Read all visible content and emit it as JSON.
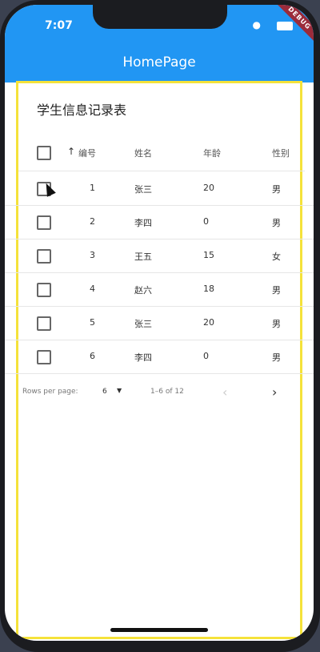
{
  "status_bar": {
    "time": "7:07",
    "debug": "DEBUG"
  },
  "app_bar": {
    "title": "HomePage"
  },
  "card": {
    "title": "学生信息记录表"
  },
  "table": {
    "columns": {
      "number": "编号",
      "name": "姓名",
      "age": "年龄",
      "gender": "性别"
    },
    "sort_icon": "arrow-up-icon",
    "rows": [
      {
        "number": "1",
        "name": "张三",
        "age": "20",
        "gender": "男"
      },
      {
        "number": "2",
        "name": "李四",
        "age": "0",
        "gender": "男"
      },
      {
        "number": "3",
        "name": "王五",
        "age": "15",
        "gender": "女"
      },
      {
        "number": "4",
        "name": "赵六",
        "age": "18",
        "gender": "男"
      },
      {
        "number": "5",
        "name": "张三",
        "age": "20",
        "gender": "男"
      },
      {
        "number": "6",
        "name": "李四",
        "age": "0",
        "gender": "男"
      }
    ]
  },
  "pagination": {
    "rows_per_page_label": "Rows per page:",
    "rows_per_page_value": "6",
    "range_text": "1–6 of 12"
  },
  "colors": {
    "app_bar": "#2196f3",
    "border": "#f5e23a"
  }
}
